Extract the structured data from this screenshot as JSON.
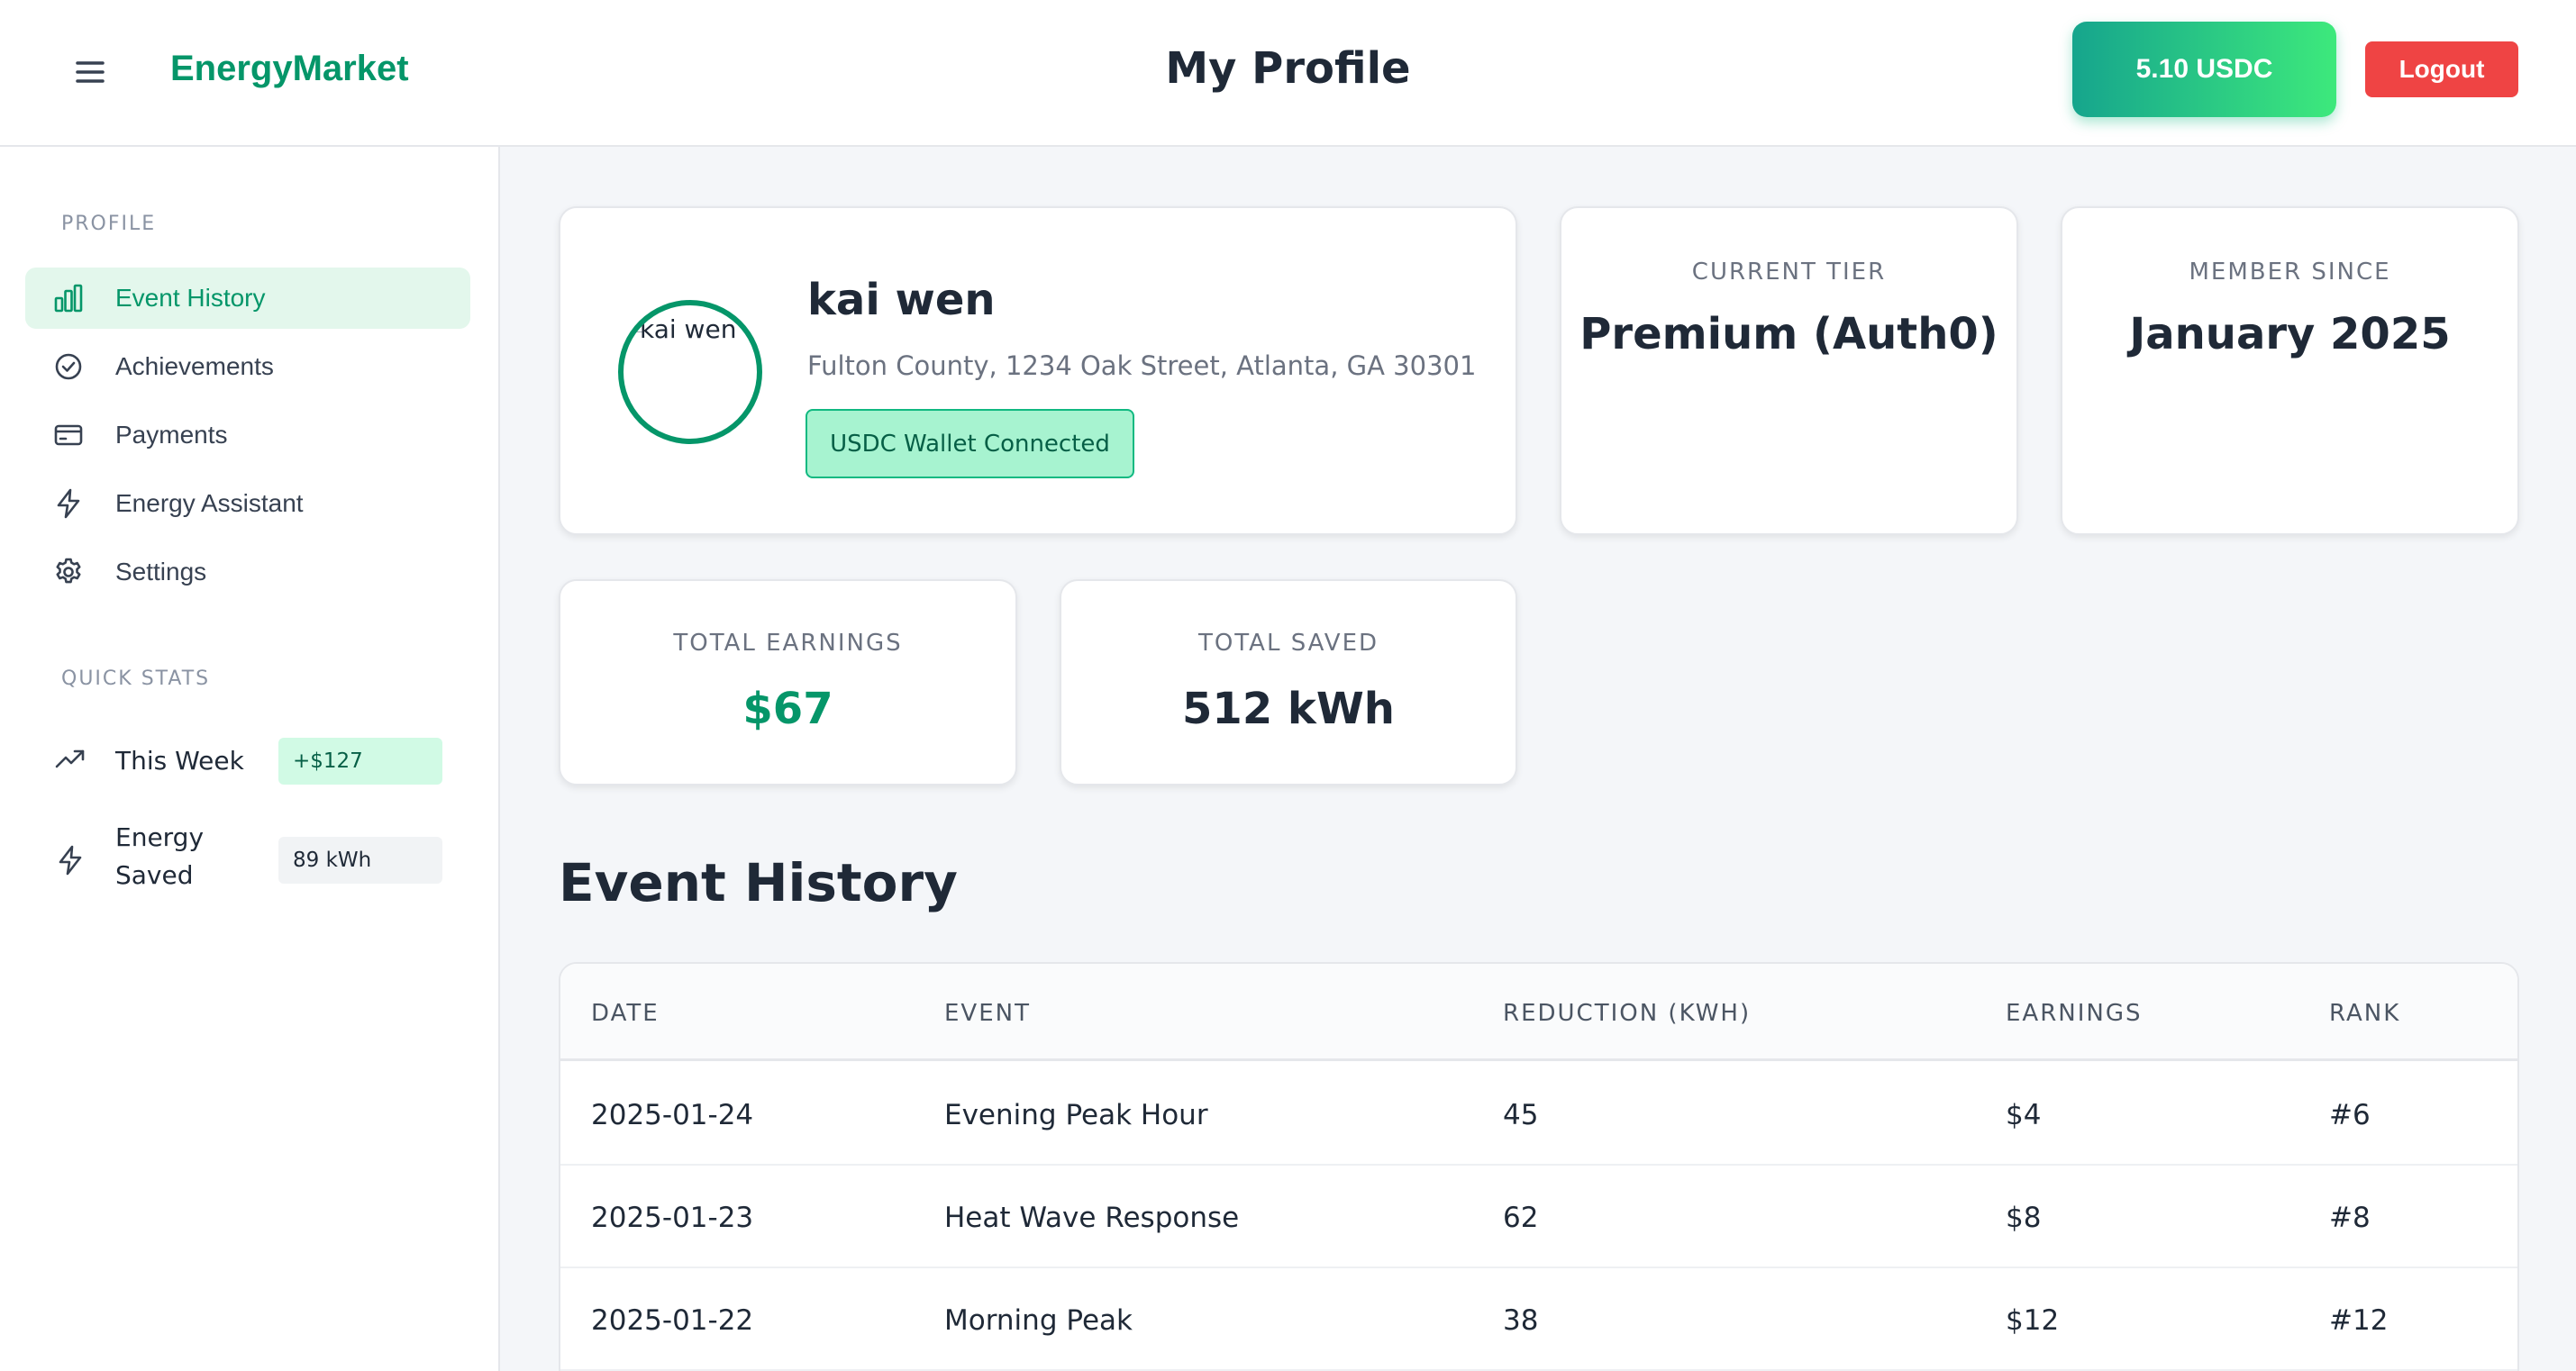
{
  "header": {
    "brand": "EnergyMarket",
    "title": "My Profile",
    "balance": "5.10 USDC",
    "logout_label": "Logout"
  },
  "sidebar": {
    "profile_section_title": "PROFILE",
    "items": [
      {
        "label": "Event History",
        "icon": "bar-chart-icon",
        "active": true
      },
      {
        "label": "Achievements",
        "icon": "check-circle-icon"
      },
      {
        "label": "Payments",
        "icon": "credit-card-icon"
      },
      {
        "label": "Energy Assistant",
        "icon": "lightning-icon"
      },
      {
        "label": "Settings",
        "icon": "gear-icon"
      }
    ],
    "quick_stats_title": "QUICK STATS",
    "quick_stats": [
      {
        "label": "This Week",
        "value": "+$127",
        "icon": "trending-up-icon"
      },
      {
        "label": "Energy Saved",
        "value": "89 kWh",
        "icon": "lightning-icon"
      }
    ]
  },
  "profile": {
    "avatar_alt": "kai wen",
    "name": "kai wen",
    "address": "Fulton County, 1234 Oak Street, Atlanta, GA 30301",
    "wallet_status": "USDC Wallet Connected"
  },
  "stats": {
    "tier": {
      "label": "CURRENT TIER",
      "value": "Premium (Auth0)"
    },
    "member_since": {
      "label": "MEMBER SINCE",
      "value": "January 2025"
    },
    "total_earnings": {
      "label": "TOTAL EARNINGS",
      "value": "$67"
    },
    "total_saved": {
      "label": "TOTAL SAVED",
      "value": "512 kWh"
    }
  },
  "event_history": {
    "title": "Event History",
    "columns": [
      "DATE",
      "EVENT",
      "REDUCTION (KWH)",
      "EARNINGS",
      "RANK"
    ],
    "rows": [
      [
        "2025-01-24",
        "Evening Peak Hour",
        "45",
        "$4",
        "#6"
      ],
      [
        "2025-01-23",
        "Heat Wave Response",
        "62",
        "$8",
        "#8"
      ],
      [
        "2025-01-22",
        "Morning Peak",
        "38",
        "$12",
        "#12"
      ]
    ]
  },
  "colors": {
    "brand": "#059669",
    "active_bg": "#e3f7ec",
    "balance_gradient_start": "#16a58d",
    "balance_gradient_end": "#3de97c",
    "logout": "#ef4444",
    "wallet_badge_bg": "#a7f3d0"
  }
}
